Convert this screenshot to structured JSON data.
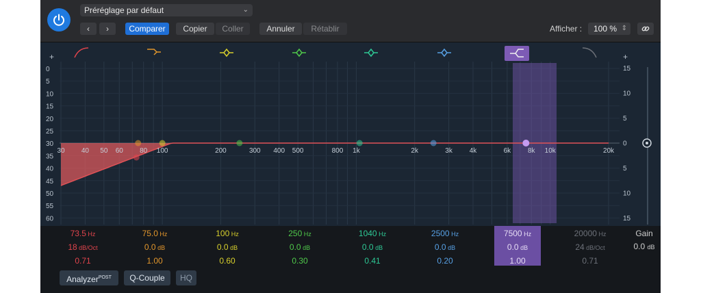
{
  "toolbar": {
    "preset": "Préréglage par défaut",
    "prev_icon": "‹",
    "next_icon": "›",
    "compare": "Comparer",
    "copy": "Copier",
    "paste": "Coller",
    "undo": "Annuler",
    "redo": "Rétablir",
    "show_label": "Afficher :",
    "zoom": "100 %"
  },
  "graph": {
    "plus_left": "+",
    "plus_right": "+",
    "left_scale": [
      "0",
      "5",
      "10",
      "15",
      "20",
      "25",
      "30",
      "35",
      "40",
      "45",
      "50",
      "55",
      "60"
    ],
    "right_scale": [
      "15",
      "10",
      "5",
      "0",
      "5",
      "10",
      "15"
    ],
    "freq_labels": [
      {
        "text": "30",
        "hz": 30
      },
      {
        "text": "40",
        "hz": 40
      },
      {
        "text": "50",
        "hz": 50
      },
      {
        "text": "60",
        "hz": 60
      },
      {
        "text": "80",
        "hz": 80
      },
      {
        "text": "100",
        "hz": 100
      },
      {
        "text": "200",
        "hz": 200
      },
      {
        "text": "300",
        "hz": 300
      },
      {
        "text": "400",
        "hz": 400
      },
      {
        "text": "500",
        "hz": 500
      },
      {
        "text": "800",
        "hz": 800
      },
      {
        "text": "1k",
        "hz": 1000
      },
      {
        "text": "2k",
        "hz": 2000
      },
      {
        "text": "3k",
        "hz": 3000
      },
      {
        "text": "4k",
        "hz": 4000
      },
      {
        "text": "6k",
        "hz": 6000
      },
      {
        "text": "8k",
        "hz": 8000
      },
      {
        "text": "10k",
        "hz": 10000
      },
      {
        "text": "20k",
        "hz": 20000
      }
    ]
  },
  "bands": [
    {
      "freq": "73.5",
      "freq_unit": "Hz",
      "gain": "18",
      "gain_unit": "dB/Oct",
      "q": "0.71",
      "color": "#e0444c",
      "icon": "low-cut-icon",
      "hz": 73.5
    },
    {
      "freq": "75.0",
      "freq_unit": "Hz",
      "gain": "0.0",
      "gain_unit": "dB",
      "q": "1.00",
      "color": "#e2962c",
      "icon": "low-shelf-icon",
      "hz": 75
    },
    {
      "freq": "100",
      "freq_unit": "Hz",
      "gain": "0.0",
      "gain_unit": "dB",
      "q": "0.60",
      "color": "#d7cf2c",
      "icon": "bell-icon",
      "hz": 100
    },
    {
      "freq": "250",
      "freq_unit": "Hz",
      "gain": "0.0",
      "gain_unit": "dB",
      "q": "0.30",
      "color": "#4fc84a",
      "icon": "bell-icon",
      "hz": 250
    },
    {
      "freq": "1040",
      "freq_unit": "Hz",
      "gain": "0.0",
      "gain_unit": "dB",
      "q": "0.41",
      "color": "#2ec895",
      "icon": "bell-icon",
      "hz": 1040
    },
    {
      "freq": "2500",
      "freq_unit": "Hz",
      "gain": "0.0",
      "gain_unit": "dB",
      "q": "0.20",
      "color": "#57a0e4",
      "icon": "bell-icon",
      "hz": 2500
    },
    {
      "freq": "7500",
      "freq_unit": "Hz",
      "gain": "0.0",
      "gain_unit": "dB",
      "q": "1.00",
      "color": "#c59bf0",
      "icon": "high-shelf-icon",
      "hz": 7500,
      "selected": true
    },
    {
      "freq": "20000",
      "freq_unit": "Hz",
      "gain": "24",
      "gain_unit": "dB/Oct",
      "q": "0.71",
      "color": "#6c7078",
      "icon": "high-cut-icon",
      "hz": 20000
    }
  ],
  "gain": {
    "label": "Gain",
    "value": "0.0",
    "unit": "dB"
  },
  "bottom": {
    "analyzer": "Analyzer",
    "analyzer_sup": "POST",
    "qcouple": "Q-Couple",
    "hq": "HQ"
  }
}
